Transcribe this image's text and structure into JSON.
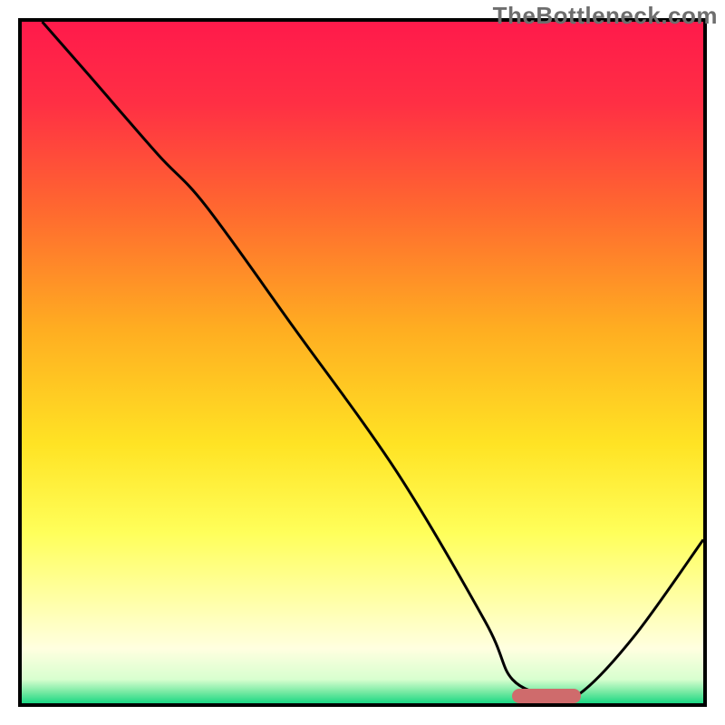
{
  "attribution": "TheBottleneck.com",
  "chart_data": {
    "type": "line",
    "title": "",
    "xlabel": "",
    "ylabel": "",
    "xlim": [
      0,
      100
    ],
    "ylim": [
      0,
      100
    ],
    "background_gradient": {
      "stops": [
        {
          "offset": 0.0,
          "color": "#ff1a4b"
        },
        {
          "offset": 0.12,
          "color": "#ff2f44"
        },
        {
          "offset": 0.28,
          "color": "#ff6a2f"
        },
        {
          "offset": 0.45,
          "color": "#ffad21"
        },
        {
          "offset": 0.62,
          "color": "#ffe324"
        },
        {
          "offset": 0.75,
          "color": "#ffff5a"
        },
        {
          "offset": 0.85,
          "color": "#ffffa8"
        },
        {
          "offset": 0.92,
          "color": "#ffffe0"
        },
        {
          "offset": 0.965,
          "color": "#d8ffcf"
        },
        {
          "offset": 0.985,
          "color": "#6fe8a0"
        },
        {
          "offset": 1.0,
          "color": "#1bd884"
        }
      ]
    },
    "series": [
      {
        "name": "bottleneck-curve",
        "color": "#000000",
        "stroke_width": 3,
        "x": [
          3.0,
          10.0,
          20.0,
          27.0,
          40.0,
          55.0,
          68.0,
          72.0,
          78.0,
          82.0,
          90.0,
          100.0
        ],
        "y": [
          100.0,
          92.0,
          80.5,
          73.0,
          55.0,
          34.0,
          12.0,
          3.5,
          1.0,
          1.5,
          10.0,
          24.0
        ]
      }
    ],
    "marker": {
      "name": "optimal-range",
      "color": "#cf6b6c",
      "x_start": 72.0,
      "x_end": 82.0,
      "y": 1.0
    }
  }
}
